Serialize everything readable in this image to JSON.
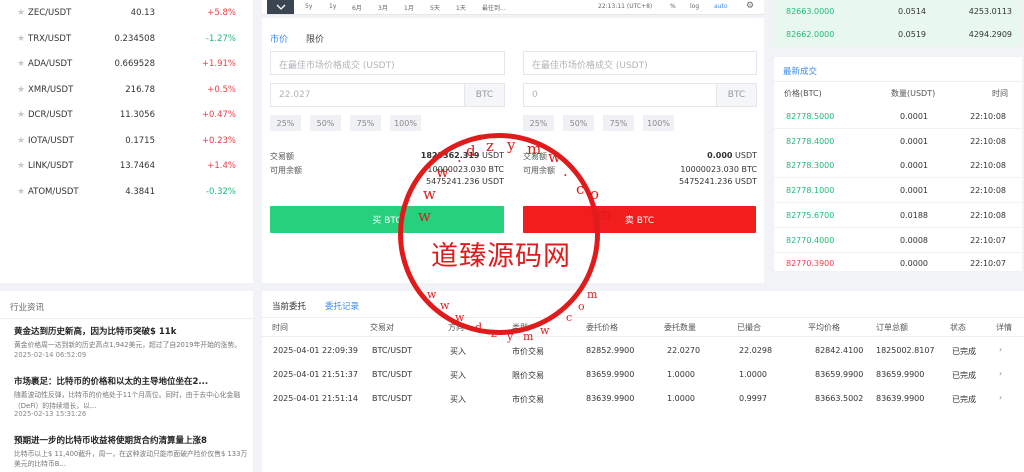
{
  "markets": [
    {
      "symbol": "ZEC/USDT",
      "price": "40.13",
      "change": "+5.8%",
      "dir": "up"
    },
    {
      "symbol": "TRX/USDT",
      "price": "0.234508",
      "change": "-1.27%",
      "dir": "down"
    },
    {
      "symbol": "ADA/USDT",
      "price": "0.669528",
      "change": "+1.91%",
      "dir": "up"
    },
    {
      "symbol": "XMR/USDT",
      "price": "216.78",
      "change": "+0.5%",
      "dir": "up"
    },
    {
      "symbol": "DCR/USDT",
      "price": "11.3056",
      "change": "+0.47%",
      "dir": "up"
    },
    {
      "symbol": "IOTA/USDT",
      "price": "0.1715",
      "change": "+0.23%",
      "dir": "up"
    },
    {
      "symbol": "LINK/USDT",
      "price": "13.7464",
      "change": "+1.4%",
      "dir": "up"
    },
    {
      "symbol": "ATOM/USDT",
      "price": "4.3841",
      "change": "-0.32%",
      "dir": "down"
    }
  ],
  "chart_toolbar": {
    "toggle_icon": "chevron-down-icon",
    "periods": [
      "5y",
      "1y",
      "6月",
      "3月",
      "1月",
      "5天",
      "1天"
    ],
    "extra": "最往到...",
    "time": "22:13:11 (UTC+8)",
    "pct": "%",
    "log": "log",
    "auto": "auto",
    "settings_icon": "gear-icon"
  },
  "trade": {
    "tabs": [
      "市价",
      "限价"
    ],
    "buy": {
      "price_placeholder": "在最佳市场价格成交 (USDT)",
      "amount": "22.027",
      "unit": "BTC",
      "percents": [
        "25%",
        "50%",
        "75%",
        "100%"
      ],
      "total_label": "交易额",
      "total_value": "1823362.319",
      "total_unit": "USDT",
      "balance_label": "可用余额",
      "balance_btc": "10000023.030 BTC",
      "balance_usdt": "5475241.236 USDT",
      "button": "买 BTC"
    },
    "sell": {
      "price_placeholder": "在最佳市场价格成交 (USDT)",
      "amount": "0",
      "unit": "BTC",
      "percents": [
        "25%",
        "50%",
        "75%",
        "100%"
      ],
      "total_label": "交易额",
      "total_value": "0.000",
      "total_unit": "USDT",
      "balance_label": "可用余额",
      "balance_btc": "10000023.030 BTC",
      "balance_usdt": "5475241.236 USDT",
      "button": "卖 BTC"
    }
  },
  "orderbook_top": [
    {
      "price": "82663.0000",
      "amount": "0.0514",
      "total": "4253.0113"
    },
    {
      "price": "82662.0000",
      "amount": "0.0519",
      "total": "4294.2909"
    }
  ],
  "trades": {
    "title": "最新成交",
    "headers": [
      "价格(BTC)",
      "数量(USDT)",
      "时间"
    ],
    "rows": [
      {
        "price": "82778.5000",
        "amount": "0.0001",
        "time": "22:10:08",
        "dir": "up"
      },
      {
        "price": "82778.4000",
        "amount": "0.0001",
        "time": "22:10:08",
        "dir": "up"
      },
      {
        "price": "82778.3000",
        "amount": "0.0001",
        "time": "22:10:08",
        "dir": "up"
      },
      {
        "price": "82778.1000",
        "amount": "0.0001",
        "time": "22:10:08",
        "dir": "up"
      },
      {
        "price": "82775.6700",
        "amount": "0.0188",
        "time": "22:10:08",
        "dir": "up"
      },
      {
        "price": "82770.4000",
        "amount": "0.0008",
        "time": "22:10:07",
        "dir": "up"
      },
      {
        "price": "82770.3900",
        "amount": "0.0000",
        "time": "22:10:07",
        "dir": "down"
      }
    ]
  },
  "news": {
    "title": "行业资讯",
    "items": [
      {
        "headline": "黄金达到历史新高，因为比特币突破$ 11k",
        "desc": "黄金价格周一达到新的历史高点1,942美元，超过了自2019年开始的涨势。",
        "date": "2025-02-14 06:52:09"
      },
      {
        "headline": "市场裹足：比特币的价格和以太的主导地位坐在2...",
        "desc": "随着波动性反弹，比特币的价格处于11个月高位。同时，由于去中心化金融",
        "desc2": "（DeFi）的持续增长，以...",
        "date": "2025-02-13 15:31:26"
      },
      {
        "headline": "预期进一步的比特币收益将使期货合约清算量上涨8",
        "desc": "比特币以上$ 11,400截升，周一，在这种波动只能市面破产险价仅售$ 133万",
        "desc2": "美元的比特币B..."
      }
    ]
  },
  "orders": {
    "tabs": [
      "当前委托",
      "委托记录"
    ],
    "headers": [
      "时间",
      "交易对",
      "方向",
      "类型",
      "委托价格",
      "委托数量",
      "已撮合",
      "平均价格",
      "订单总额",
      "状态",
      "详情"
    ],
    "rows": [
      {
        "time": "2025-04-01 22:09:39",
        "pair": "BTC/USDT",
        "side": "买入",
        "type": "市价交易",
        "price": "82852.9900",
        "qty": "22.0270",
        "filled": "22.0298",
        "avg": "82842.4100",
        "total": "1825002.8107",
        "status": "已完成"
      },
      {
        "time": "2025-04-01 21:51:37",
        "pair": "BTC/USDT",
        "side": "买入",
        "type": "限价交易",
        "price": "83659.9900",
        "qty": "1.0000",
        "filled": "1.0000",
        "avg": "83659.9900",
        "total": "83659.9900",
        "status": "已完成"
      },
      {
        "time": "2025-04-01 21:51:14",
        "pair": "BTC/USDT",
        "side": "买入",
        "type": "市价交易",
        "price": "83639.9900",
        "qty": "1.0000",
        "filled": "0.9997",
        "avg": "83663.5002",
        "total": "83639.9900",
        "status": "已完成"
      }
    ]
  },
  "watermark": {
    "text": "道臻源码网",
    "url": "www.dzym.com"
  }
}
